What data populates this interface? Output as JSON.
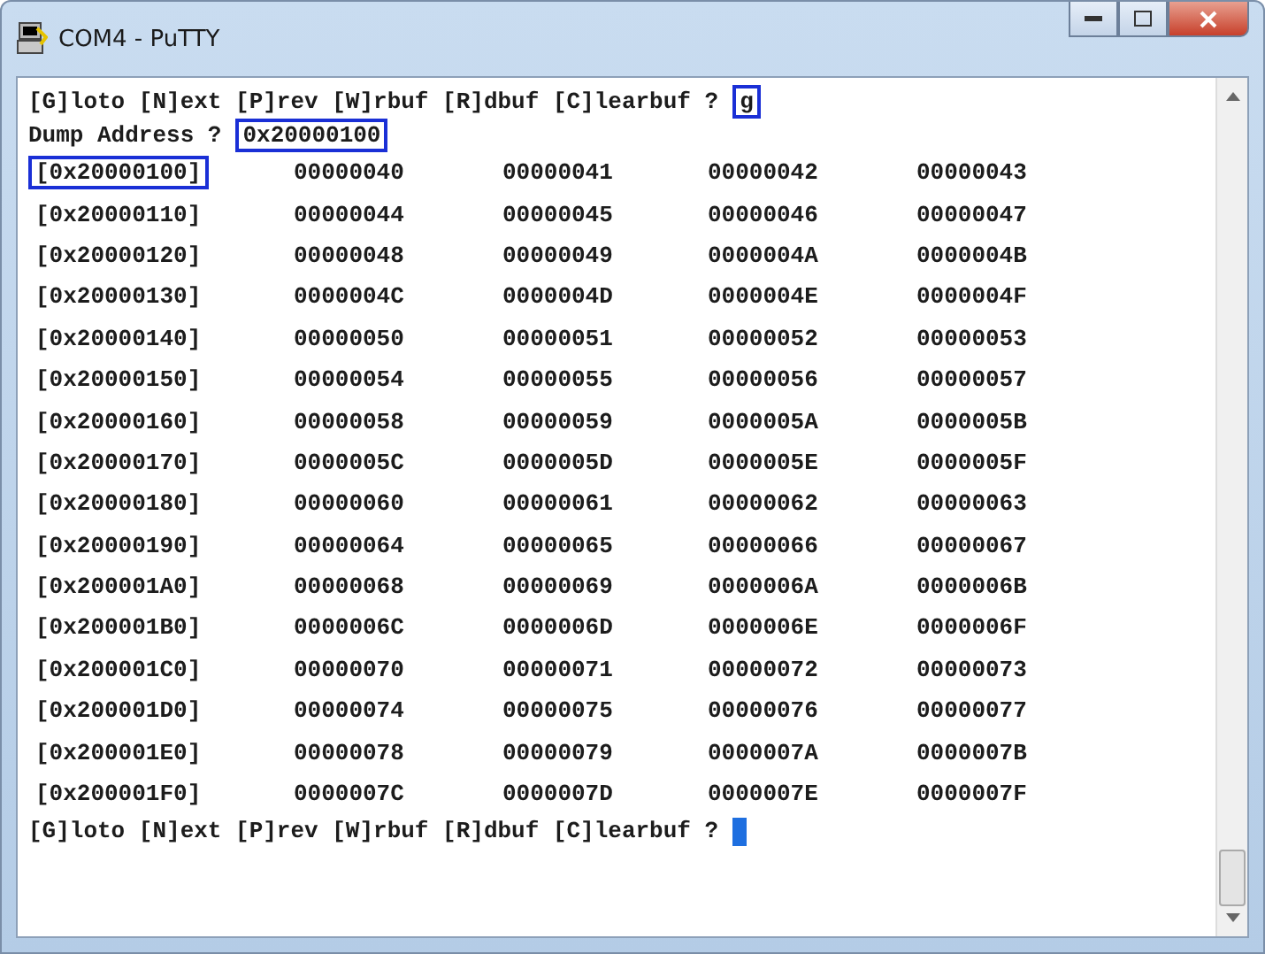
{
  "window": {
    "title": "COM4 - PuTTY"
  },
  "terminal": {
    "command_prompt": {
      "text": "[G]loto [N]ext [P]rev [W]rbuf [R]dbuf [C]learbuf ?",
      "input": {
        "text": "g",
        "highlighted": true
      }
    },
    "dump_prompt": {
      "label": "Dump Address ?",
      "input": {
        "text": "0x20000100",
        "highlighted": true
      }
    },
    "rows": [
      {
        "address": "[0x20000100]",
        "highlighted": true,
        "values": [
          "00000040",
          "00000041",
          "00000042",
          "00000043"
        ]
      },
      {
        "address": "[0x20000110]",
        "highlighted": false,
        "values": [
          "00000044",
          "00000045",
          "00000046",
          "00000047"
        ]
      },
      {
        "address": "[0x20000120]",
        "highlighted": false,
        "values": [
          "00000048",
          "00000049",
          "0000004A",
          "0000004B"
        ]
      },
      {
        "address": "[0x20000130]",
        "highlighted": false,
        "values": [
          "0000004C",
          "0000004D",
          "0000004E",
          "0000004F"
        ]
      },
      {
        "address": "[0x20000140]",
        "highlighted": false,
        "values": [
          "00000050",
          "00000051",
          "00000052",
          "00000053"
        ]
      },
      {
        "address": "[0x20000150]",
        "highlighted": false,
        "values": [
          "00000054",
          "00000055",
          "00000056",
          "00000057"
        ]
      },
      {
        "address": "[0x20000160]",
        "highlighted": false,
        "values": [
          "00000058",
          "00000059",
          "0000005A",
          "0000005B"
        ]
      },
      {
        "address": "[0x20000170]",
        "highlighted": false,
        "values": [
          "0000005C",
          "0000005D",
          "0000005E",
          "0000005F"
        ]
      },
      {
        "address": "[0x20000180]",
        "highlighted": false,
        "values": [
          "00000060",
          "00000061",
          "00000062",
          "00000063"
        ]
      },
      {
        "address": "[0x20000190]",
        "highlighted": false,
        "values": [
          "00000064",
          "00000065",
          "00000066",
          "00000067"
        ]
      },
      {
        "address": "[0x200001A0]",
        "highlighted": false,
        "values": [
          "00000068",
          "00000069",
          "0000006A",
          "0000006B"
        ]
      },
      {
        "address": "[0x200001B0]",
        "highlighted": false,
        "values": [
          "0000006C",
          "0000006D",
          "0000006E",
          "0000006F"
        ]
      },
      {
        "address": "[0x200001C0]",
        "highlighted": false,
        "values": [
          "00000070",
          "00000071",
          "00000072",
          "00000073"
        ]
      },
      {
        "address": "[0x200001D0]",
        "highlighted": false,
        "values": [
          "00000074",
          "00000075",
          "00000076",
          "00000077"
        ]
      },
      {
        "address": "[0x200001E0]",
        "highlighted": false,
        "values": [
          "00000078",
          "00000079",
          "0000007A",
          "0000007B"
        ]
      },
      {
        "address": "[0x200001F0]",
        "highlighted": false,
        "values": [
          "0000007C",
          "0000007D",
          "0000007E",
          "0000007F"
        ]
      }
    ],
    "final_prompt": {
      "text": "[G]loto [N]ext [P]rev [W]rbuf [R]dbuf [C]learbuf ?",
      "cursor": true
    }
  }
}
